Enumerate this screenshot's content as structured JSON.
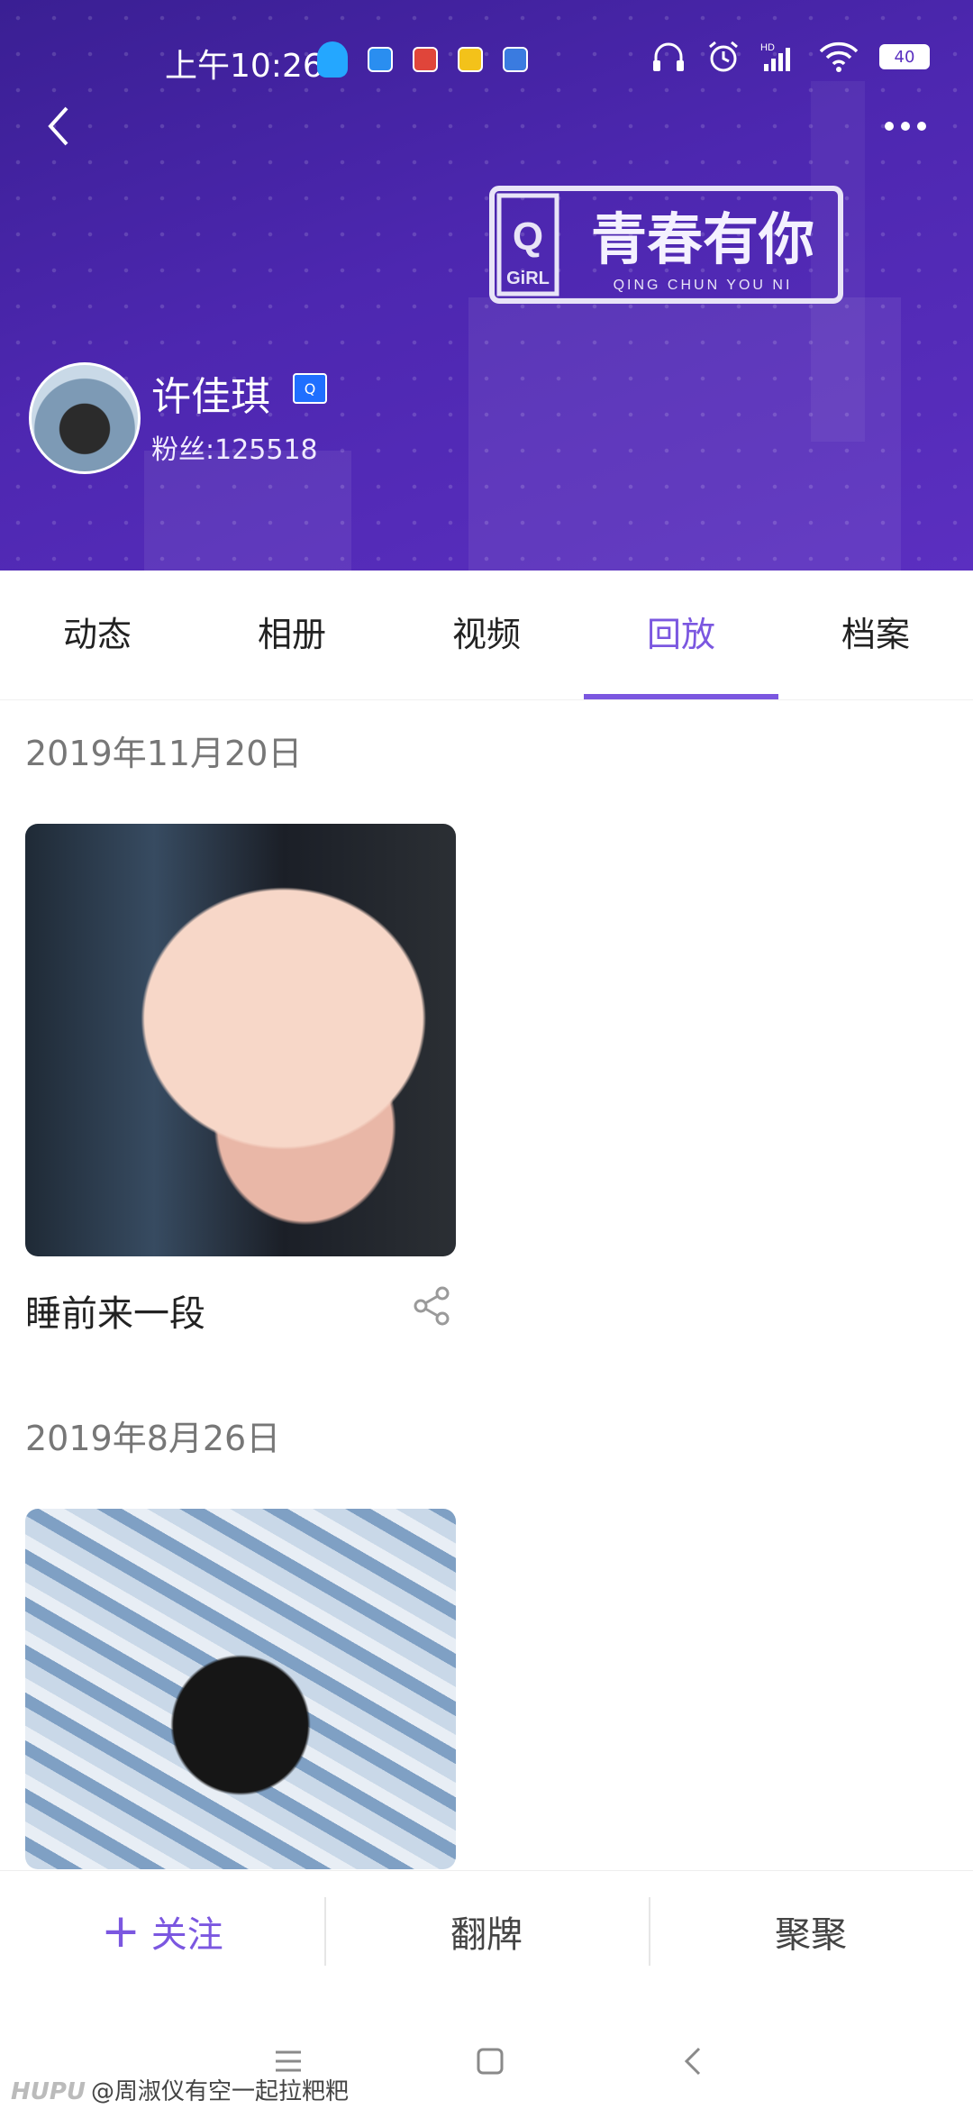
{
  "status_bar": {
    "time": "上午10:26",
    "battery": "40"
  },
  "header": {
    "logo_main": "青春有你",
    "logo_sub": "QING CHUN YOU NI",
    "logo_badge": "GiRL",
    "name": "许佳琪",
    "name_badge": "Q",
    "fans": "粉丝:125518"
  },
  "tabs": [
    {
      "label": "动态",
      "active": false
    },
    {
      "label": "相册",
      "active": false
    },
    {
      "label": "视频",
      "active": false
    },
    {
      "label": "回放",
      "active": true
    },
    {
      "label": "档案",
      "active": false
    }
  ],
  "items": [
    {
      "date": "2019年11月20日",
      "title": "睡前来一段"
    },
    {
      "date": "2019年8月26日",
      "title": ""
    }
  ],
  "actions": {
    "follow": "关注",
    "flip": "翻牌",
    "gather": "聚聚"
  },
  "watermark": {
    "brand": "HUPU",
    "text": "@周淑仪有空一起拉粑粑"
  },
  "colors": {
    "accent": "#7b57e0",
    "banner": "#4d27b0"
  }
}
